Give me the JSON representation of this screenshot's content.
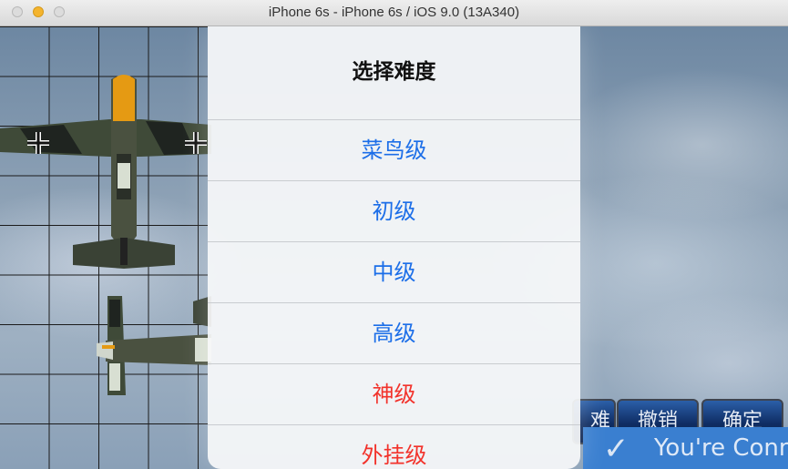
{
  "window": {
    "title": "iPhone 6s - iPhone 6s / iOS 9.0 (13A340)"
  },
  "action_sheet": {
    "title": "选择难度",
    "options": [
      {
        "label": "菜鸟级",
        "color": "#1c6ee8"
      },
      {
        "label": "初级",
        "color": "#1c6ee8"
      },
      {
        "label": "中级",
        "color": "#1c6ee8"
      },
      {
        "label": "高级",
        "color": "#1c6ee8"
      },
      {
        "label": "神级",
        "color": "#f2322b"
      },
      {
        "label": "外挂级",
        "color": "#f2322b"
      }
    ]
  },
  "toolbar": {
    "difficulty_label": "难度",
    "undo_label": "撤销",
    "confirm_label": "确定"
  },
  "banner": {
    "text": "You're Conn",
    "icon": "checkmark-icon"
  }
}
